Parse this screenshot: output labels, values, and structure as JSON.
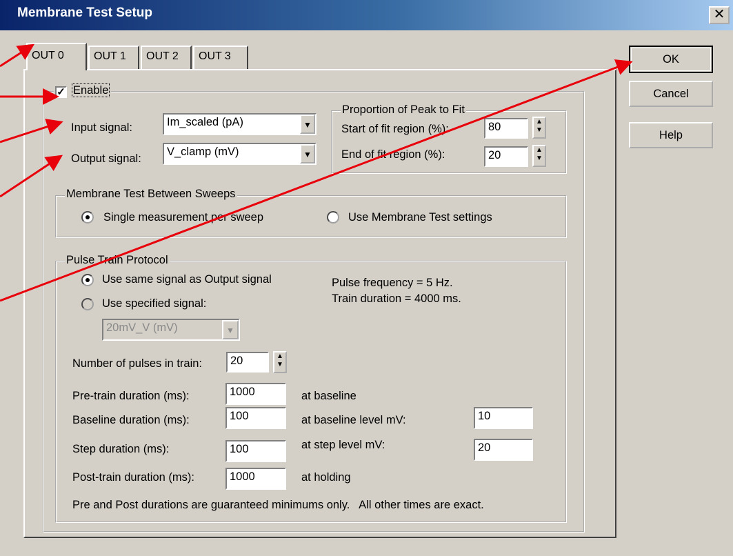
{
  "window": {
    "title": "Membrane Test Setup",
    "close_glyph": "✕"
  },
  "tabs": [
    "OUT 0",
    "OUT 1",
    "OUT 2",
    "OUT 3"
  ],
  "enable": {
    "label": "Enable",
    "checked": true
  },
  "input_signal": {
    "label": "Input signal:",
    "value": "Im_scaled (pA)"
  },
  "output_signal": {
    "label": "Output signal:",
    "value": "V_clamp (mV)"
  },
  "proportion": {
    "title": "Proportion of Peak to Fit",
    "start_label": "Start of fit region (%):",
    "start_value": "80",
    "end_label": "End of fit region (%):",
    "end_value": "20"
  },
  "between_sweeps": {
    "title": "Membrane Test Between Sweeps",
    "option1": "Single measurement per sweep",
    "option2": "Use Membrane Test settings",
    "selected": 1
  },
  "pulse_train": {
    "title": "Pulse Train Protocol",
    "option1": "Use same signal as Output signal",
    "option2": "Use specified signal:",
    "selected": 1,
    "specified_signal": "20mV_V (mV)",
    "frequency_text": "Pulse frequency = 5 Hz.",
    "duration_text": "Train duration = 4000 ms.",
    "num_pulses_label": "Number of pulses in train:",
    "num_pulses": "20",
    "pre_train_label": "Pre-train duration (ms):",
    "pre_train_value": "1000",
    "pre_train_note": "at baseline",
    "baseline_label": "Baseline duration (ms):",
    "baseline_value": "100",
    "baseline_note": "at baseline level mV:",
    "baseline_level": "10",
    "step_label": "Step duration (ms):",
    "step_value": "100",
    "step_note": "at step level mV:",
    "step_level": "20",
    "post_train_label": "Post-train duration (ms):",
    "post_train_value": "1000",
    "post_train_note": "at holding",
    "footnote": "Pre and Post durations are guaranteed minimums only.   All other times are exact."
  },
  "buttons": {
    "ok": "OK",
    "cancel": "Cancel",
    "help": "Help"
  },
  "colors": {
    "annotation_arrow": "#e8000b",
    "titlebar_start": "#0a246a",
    "dialog_bg": "#d4d0c8"
  },
  "icons": {
    "checkbox": "check-icon",
    "dropdown": "triangle-down-icon",
    "spinner": "up-down-arrows-icon",
    "close": "close-icon"
  }
}
